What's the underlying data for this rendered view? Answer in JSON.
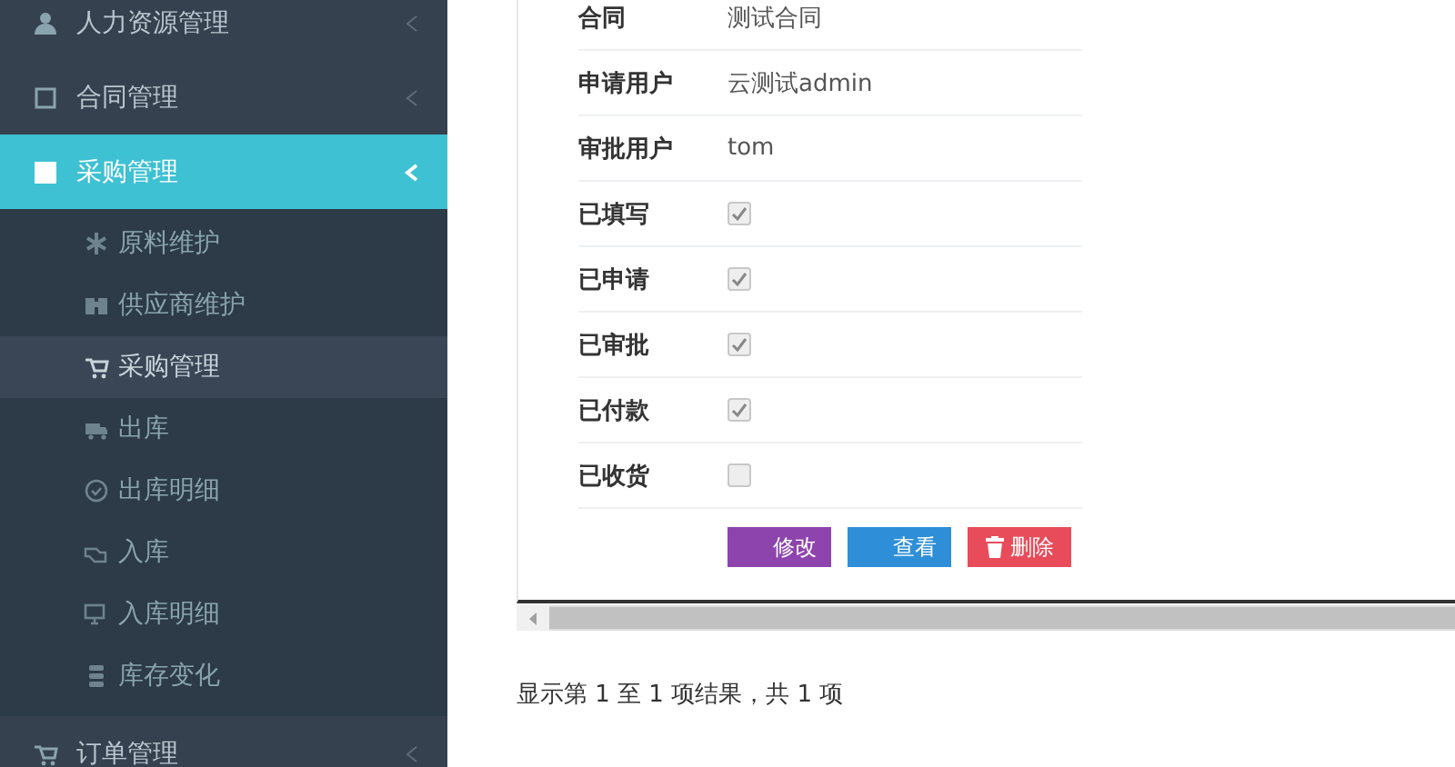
{
  "sidebar": {
    "items": [
      {
        "label": "人力资源管理",
        "selected": false,
        "expanded": false
      },
      {
        "label": "合同管理",
        "selected": false,
        "expanded": false
      },
      {
        "label": "采购管理",
        "selected": true,
        "expanded": true,
        "children": [
          {
            "label": "原料维护",
            "selected": false
          },
          {
            "label": "供应商维护",
            "selected": false
          },
          {
            "label": "采购管理",
            "selected": true
          },
          {
            "label": "出库",
            "selected": false
          },
          {
            "label": "出库明细",
            "selected": false
          },
          {
            "label": "入库",
            "selected": false
          },
          {
            "label": "入库明细",
            "selected": false
          },
          {
            "label": "库存变化",
            "selected": false
          }
        ]
      },
      {
        "label": "订单管理",
        "selected": false,
        "expanded": false
      }
    ]
  },
  "detail": {
    "rows": [
      {
        "kind": "text",
        "label": "合同",
        "value": "测试合同"
      },
      {
        "kind": "text",
        "label": "申请用户",
        "value": "云测试admin"
      },
      {
        "kind": "text",
        "label": "审批用户",
        "value": "tom"
      },
      {
        "kind": "check",
        "label": "已填写",
        "checked": true
      },
      {
        "kind": "check",
        "label": "已申请",
        "checked": true
      },
      {
        "kind": "check",
        "label": "已审批",
        "checked": true
      },
      {
        "kind": "check",
        "label": "已付款",
        "checked": true
      },
      {
        "kind": "check",
        "label": "已收货",
        "checked": false
      }
    ],
    "buttons": [
      {
        "kind": "edit",
        "label": "修改"
      },
      {
        "kind": "view",
        "label": "查看"
      },
      {
        "kind": "delete",
        "label": "删除"
      }
    ]
  },
  "footer": "显示第 1 至 1 项结果，共 1 项"
}
